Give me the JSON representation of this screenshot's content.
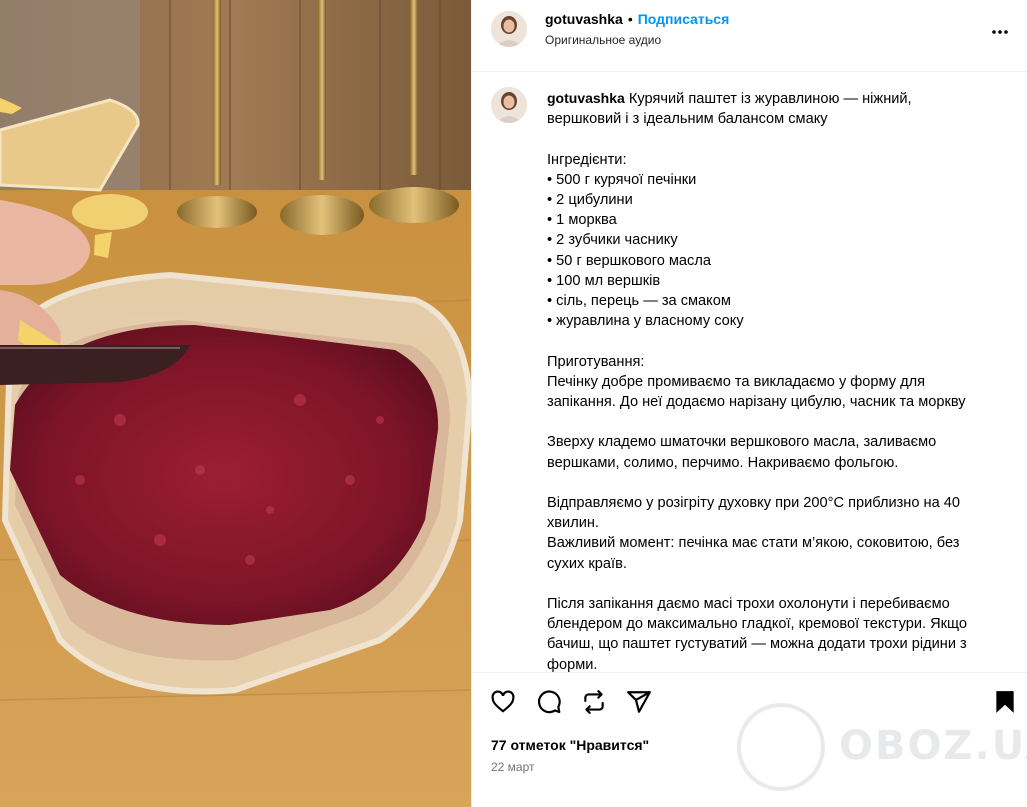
{
  "post": {
    "username": "gotuvashka",
    "follow_label": "Подписаться",
    "dot": "•",
    "audio_label": "Оригинальное аудио",
    "caption_username": "gotuvashka",
    "caption_text": " Курячий паштет із журавлиною — ніжний,\nвершковий і з ідеальним балансом смаку\n\nІнгредієнти:\n• 500 г курячої печінки\n• 2 цибулини\n• 1 морква\n• 2 зубчики часнику\n• 50 г вершкового масла\n• 100 мл вершків\n• сіль, перець — за смаком\n• журавлина у власному соку\n\nПриготування:\nПечінку добре промиваємо та викладаємо у форму для\nзапікання. До неї додаємо нарізану цибулю, часник та моркву\n\nЗверху кладемо шматочки вершкового масла, заливаємо\nвершками, солимо, перчимо. Накриваємо фольгою.\n\nВідправляємо у розігріту духовку при 200°С приблизно на 40\nхвилин.\nВажливий момент: печінка має стати м’якою, соковитою, без\nсухих країв.\n\nПісля запікання даємо масі трохи охолонути і перебиваємо\nблендером до максимально гладкої, кремової текстури. Якщо\nбачиш, що паштет густуватий — можна додати трохи рідини з\nформи.",
    "likes": "77 отметок \"Нравится\"",
    "date": "22 март"
  },
  "watermark": {
    "text": "OBOZ.UA"
  },
  "icons": {
    "more": "more-options-icon",
    "like": "heart-icon",
    "comment": "comment-icon",
    "repost": "repost-icon",
    "share": "send-icon",
    "save": "bookmark-icon"
  },
  "colors": {
    "accent": "#0095f6",
    "muted": "#737373",
    "jam": "#8e1a2e"
  }
}
